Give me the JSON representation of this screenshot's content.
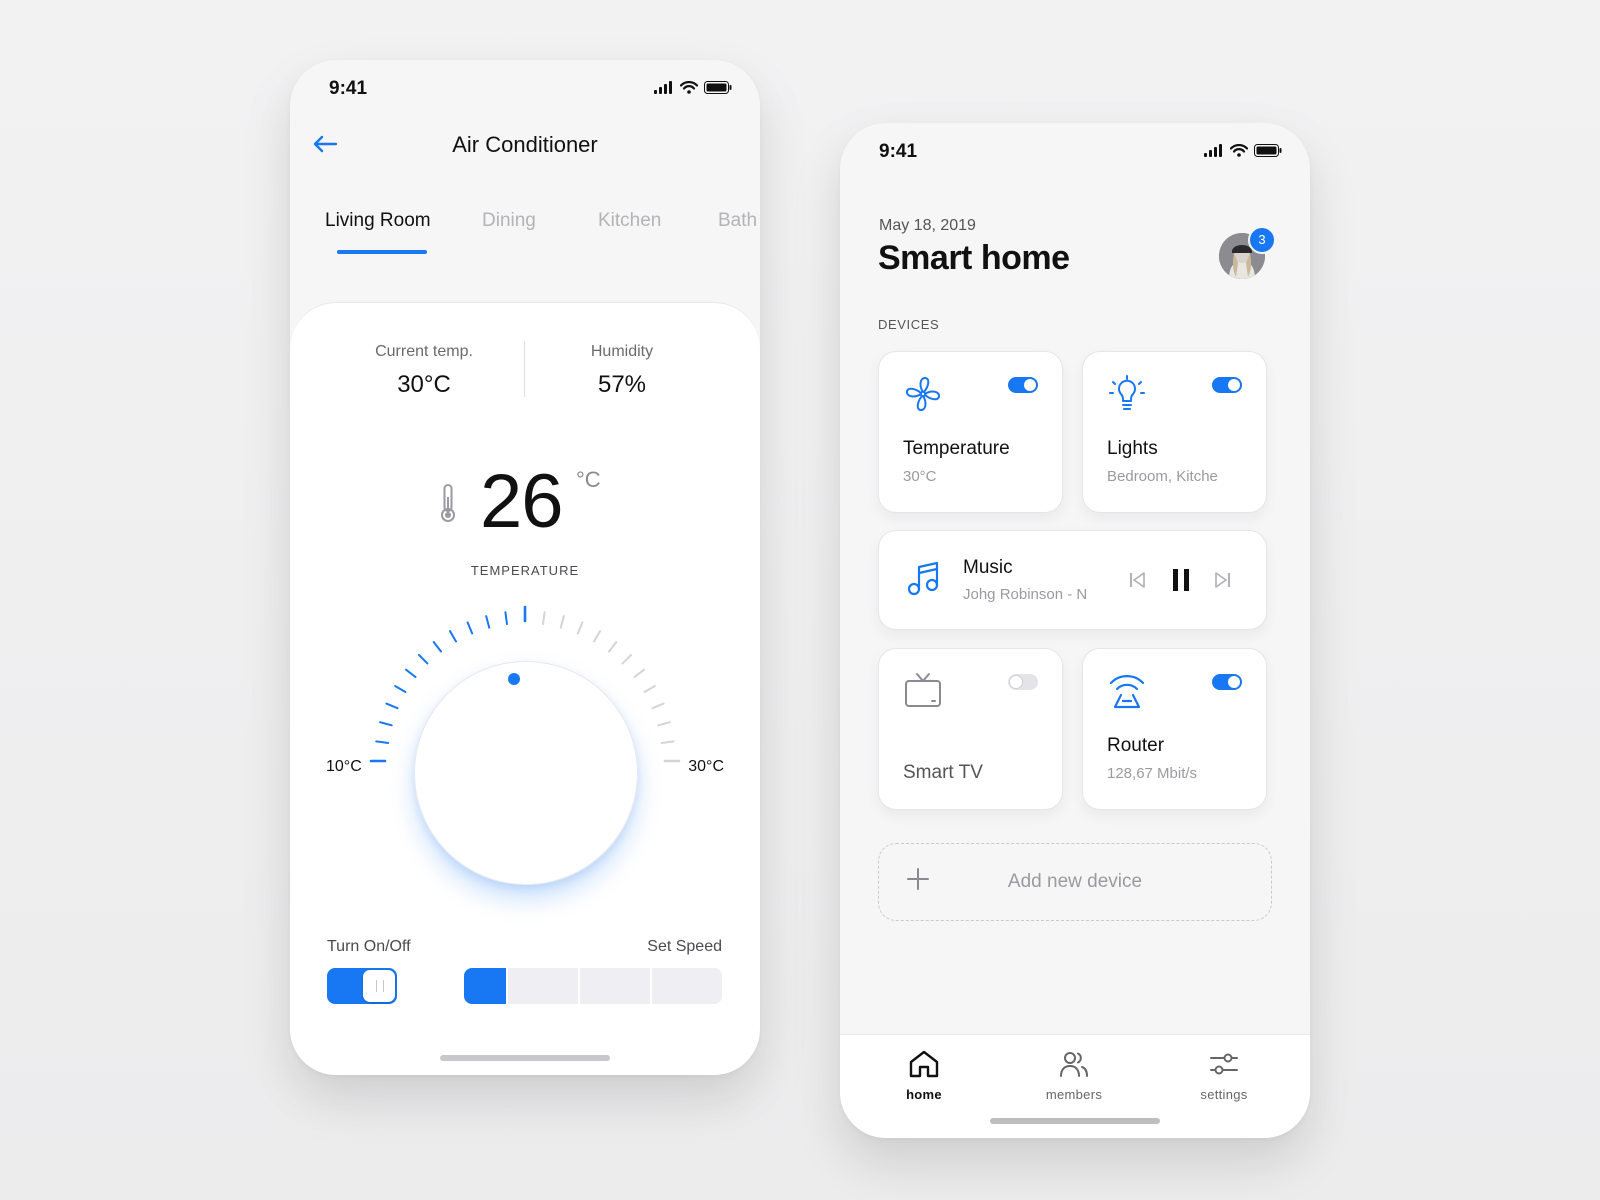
{
  "status_bar": {
    "time": "9:41"
  },
  "ac_screen": {
    "title": "Air Conditioner",
    "tabs": [
      "Living Room",
      "Dining",
      "Kitchen",
      "Bath"
    ],
    "active_tab": "Living Room",
    "current_temp": {
      "label": "Current temp.",
      "value": "30°C"
    },
    "humidity": {
      "label": "Humidity",
      "value": "57%"
    },
    "set_temperature": {
      "value": "26",
      "unit": "°C",
      "caption": "TEMPERATURE"
    },
    "dial": {
      "min_label": "10°C",
      "max_label": "30°C",
      "min": 10,
      "max": 30,
      "value": 26
    },
    "power": {
      "label": "Turn On/Off",
      "on": true
    },
    "speed": {
      "label": "Set Speed",
      "level": 1,
      "levels": 4
    }
  },
  "home_screen": {
    "date": "May 18, 2019",
    "title": "Smart home",
    "notification_count": "3",
    "section_label": "DEVICES",
    "devices": [
      {
        "name": "Temperature",
        "detail": "30°C",
        "on": true,
        "icon": "fan-icon"
      },
      {
        "name": "Lights",
        "detail": "Bedroom, Kitche",
        "on": true,
        "icon": "lightbulb-icon"
      },
      {
        "name": "Music",
        "detail": "Johg Robinson - N",
        "playing": true,
        "icon": "music-note-icon"
      },
      {
        "name": "Smart TV",
        "detail": "",
        "on": false,
        "icon": "tv-icon"
      },
      {
        "name": "Router",
        "detail": "128,67 Mbit/s",
        "on": true,
        "icon": "router-icon"
      }
    ],
    "add_device_label": "Add new device",
    "nav": [
      {
        "label": "home",
        "icon": "home-icon",
        "active": true
      },
      {
        "label": "members",
        "icon": "members-icon",
        "active": false
      },
      {
        "label": "settings",
        "icon": "sliders-icon",
        "active": false
      }
    ]
  },
  "colors": {
    "accent": "#1877f2",
    "muted_text": "#9a9aa0",
    "card_bg": "#ffffff",
    "screen_bg": "#f6f6f7"
  }
}
